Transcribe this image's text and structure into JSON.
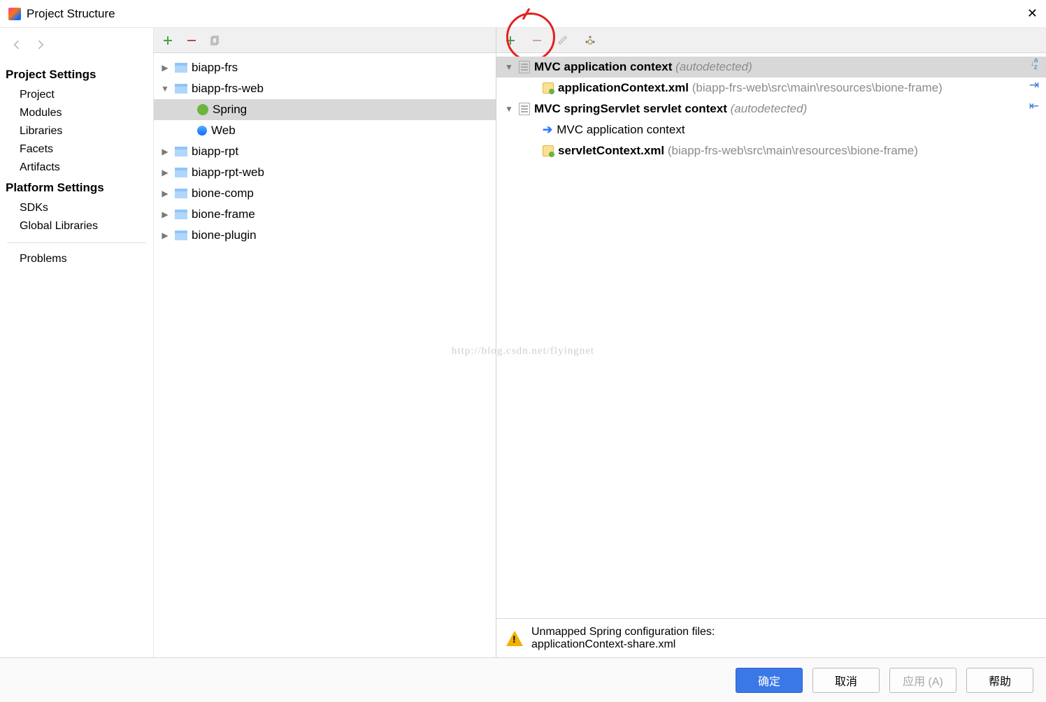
{
  "title": "Project Structure",
  "watermark": "http://blog.csdn.net/flyingnet",
  "sidebar": {
    "project_settings_label": "Project Settings",
    "project_items": [
      {
        "label": "Project"
      },
      {
        "label": "Modules"
      },
      {
        "label": "Libraries"
      },
      {
        "label": "Facets"
      },
      {
        "label": "Artifacts"
      }
    ],
    "platform_settings_label": "Platform Settings",
    "platform_items": [
      {
        "label": "SDKs"
      },
      {
        "label": "Global Libraries"
      }
    ],
    "problems_label": "Problems"
  },
  "modules": {
    "items": [
      {
        "label": "biapp-frs",
        "depth": 0,
        "expanded": false,
        "type": "folder"
      },
      {
        "label": "biapp-frs-web",
        "depth": 0,
        "expanded": true,
        "type": "folder"
      },
      {
        "label": "Spring",
        "depth": 1,
        "expanded": false,
        "type": "spring",
        "selected": true
      },
      {
        "label": "Web",
        "depth": 1,
        "expanded": false,
        "type": "web"
      },
      {
        "label": "biapp-rpt",
        "depth": 0,
        "expanded": false,
        "type": "folder"
      },
      {
        "label": "biapp-rpt-web",
        "depth": 0,
        "expanded": false,
        "type": "folder"
      },
      {
        "label": "bione-comp",
        "depth": 0,
        "expanded": false,
        "type": "folder"
      },
      {
        "label": "bione-frame",
        "depth": 0,
        "expanded": false,
        "type": "folder"
      },
      {
        "label": "bione-plugin",
        "depth": 0,
        "expanded": false,
        "type": "folder"
      }
    ]
  },
  "contexts": {
    "rows": [
      {
        "depth": 0,
        "chev": "down",
        "icon": "page",
        "bold": "MVC application context",
        "dim": "(autodetected)",
        "selected": true
      },
      {
        "depth": 1,
        "icon": "xml",
        "bold": "applicationContext.xml",
        "path": "(biapp-frs-web\\src\\main\\resources\\bione-frame)"
      },
      {
        "depth": 0,
        "chev": "down",
        "icon": "page",
        "bold": "MVC springServlet servlet context",
        "dim": "(autodetected)"
      },
      {
        "depth": 1,
        "icon": "arrow",
        "plain": "MVC application context"
      },
      {
        "depth": 1,
        "icon": "xml",
        "bold": "servletContext.xml",
        "path": "(biapp-frs-web\\src\\main\\resources\\bione-frame)"
      }
    ]
  },
  "warning": {
    "line1": "Unmapped Spring configuration files:",
    "line2": "applicationContext-share.xml"
  },
  "buttons": {
    "ok": "确定",
    "cancel": "取消",
    "apply": "应用 (A)",
    "help": "帮助"
  }
}
